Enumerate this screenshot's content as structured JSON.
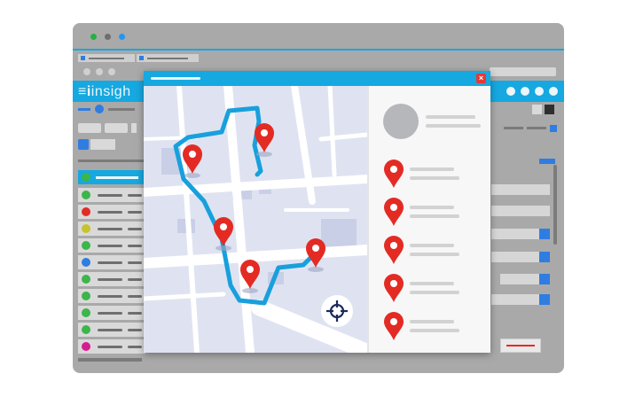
{
  "app": {
    "logo_text": "insigh",
    "logo_prefix_icon": "hamburger-icon"
  },
  "window_controls": {
    "colors": [
      "#26b043",
      "#6e6e6e",
      "#2196f3"
    ]
  },
  "modal": {
    "close_label": "×",
    "accent_color": "#16a8e0",
    "route_color": "#18a0dc",
    "pin_color": "#e32b24"
  },
  "map": {
    "locate_icon": "crosshair-icon",
    "pins": [
      {
        "name": "pin-1"
      },
      {
        "name": "pin-2"
      },
      {
        "name": "pin-3"
      },
      {
        "name": "pin-4"
      },
      {
        "name": "pin-5"
      }
    ]
  },
  "list": {
    "items": [
      {
        "icon": "location-pin-icon"
      },
      {
        "icon": "location-pin-icon"
      },
      {
        "icon": "location-pin-icon"
      },
      {
        "icon": "location-pin-icon"
      },
      {
        "icon": "location-pin-icon"
      }
    ]
  },
  "background_table": {
    "status_colors": [
      "#3cb54a",
      "#e32b24",
      "#c7c32a",
      "#3cb54a",
      "#2f7de1",
      "#3cb54a",
      "#3cb54a",
      "#3cb54a",
      "#3cb54a",
      "#d81b8f"
    ]
  }
}
